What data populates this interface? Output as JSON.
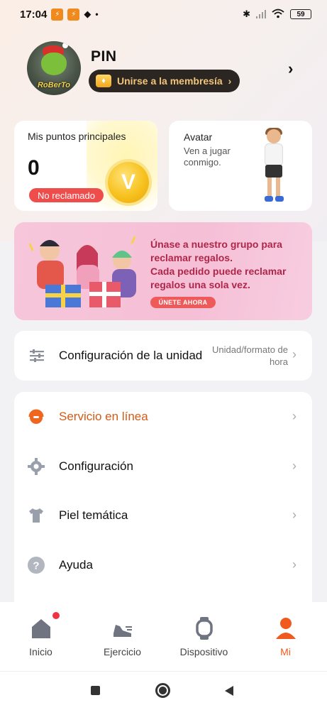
{
  "status_bar": {
    "time": "17:04",
    "battery": "59"
  },
  "profile": {
    "avatar_tag": "RoBerTo",
    "username": "PIN",
    "membership_label": "Unirse a la membresía"
  },
  "points": {
    "title": "Mis puntos principales",
    "value": "0",
    "status": "No reclamado"
  },
  "avatar_card": {
    "title": "Avatar",
    "subtitle": "Ven a jugar conmigo."
  },
  "banner": {
    "line1": "Únase a nuestro grupo para",
    "line2": "reclamar regalos.",
    "line3": "Cada pedido puede reclamar",
    "line4": "regalos una sola vez.",
    "button": "ÚNETE AHORA"
  },
  "unit_settings": {
    "label": "Configuración de la unidad",
    "value_line1": "Unidad/formato de",
    "value_line2": "hora"
  },
  "menu": {
    "items": [
      {
        "label": "Servicio en línea"
      },
      {
        "label": "Configuración"
      },
      {
        "label": "Piel temática"
      },
      {
        "label": "Ayuda"
      }
    ]
  },
  "bottom_nav": {
    "items": [
      {
        "label": "Inicio"
      },
      {
        "label": "Ejercicio"
      },
      {
        "label": "Dispositivo"
      },
      {
        "label": "Mi"
      }
    ]
  },
  "colors": {
    "accent": "#f05a1e",
    "badge_red": "#ef4c4c",
    "banner_text": "#b0264a"
  }
}
